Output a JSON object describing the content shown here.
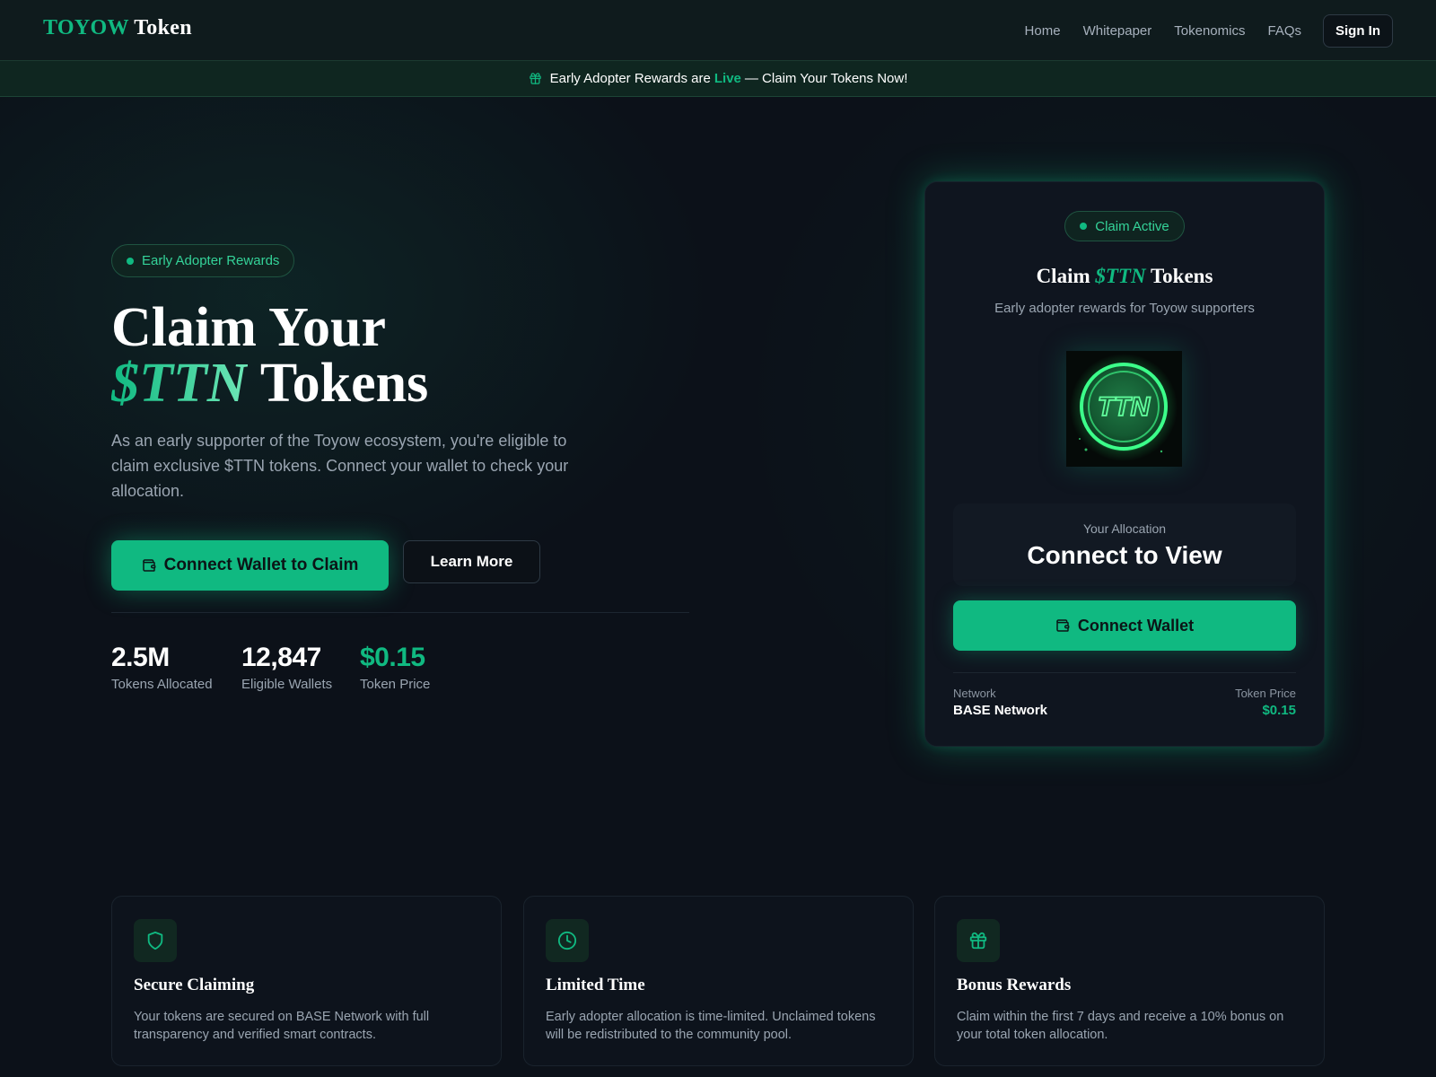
{
  "header": {
    "logo_accent": "TOYOW",
    "logo_rest": "Token",
    "nav": [
      "Home",
      "Whitepaper",
      "Tokenomics",
      "FAQs"
    ],
    "signin_label": "Sign In"
  },
  "banner": {
    "text_before": "Early Adopter Rewards are",
    "live": "Live",
    "text_after": "— Claim Your Tokens Now!"
  },
  "hero": {
    "pill": "Early Adopter Rewards",
    "title_line1": "Claim Your",
    "title_accent": "$TTN",
    "title_rest": "Tokens",
    "description": "As an early supporter of the Toyow ecosystem, you're eligible to claim exclusive $TTN tokens. Connect your wallet to check your allocation.",
    "primary_button": "Connect Wallet to Claim",
    "secondary_button": "Learn More",
    "stats": [
      {
        "value": "2.5M",
        "label": "Tokens Allocated"
      },
      {
        "value": "12,847",
        "label": "Eligible Wallets"
      },
      {
        "value": "$0.15",
        "label": "Token Price"
      }
    ]
  },
  "card": {
    "status": "Claim Active",
    "title_before": "Claim",
    "title_accent": "$TTN",
    "title_after": "Tokens",
    "subtitle": "Early adopter rewards for Toyow supporters",
    "coin_label": "TTN",
    "allocation_label": "Your Allocation",
    "allocation_value": "Connect to View",
    "button": "Connect Wallet",
    "network_label": "Network",
    "network_value": "BASE Network",
    "price_label": "Token Price",
    "price_value": "$0.15"
  },
  "features": [
    {
      "icon": "shield-icon",
      "title": "Secure Claiming",
      "desc": "Your tokens are secured on BASE Network with full transparency and verified smart contracts."
    },
    {
      "icon": "clock-icon",
      "title": "Limited Time",
      "desc": "Early adopter allocation is time-limited. Unclaimed tokens will be redistributed to the community pool."
    },
    {
      "icon": "gift-icon",
      "title": "Bonus Rewards",
      "desc": "Claim within the first 7 days and receive a 10% bonus on your total token allocation."
    }
  ],
  "colors": {
    "accent": "#10b981",
    "background": "#0c1119"
  }
}
